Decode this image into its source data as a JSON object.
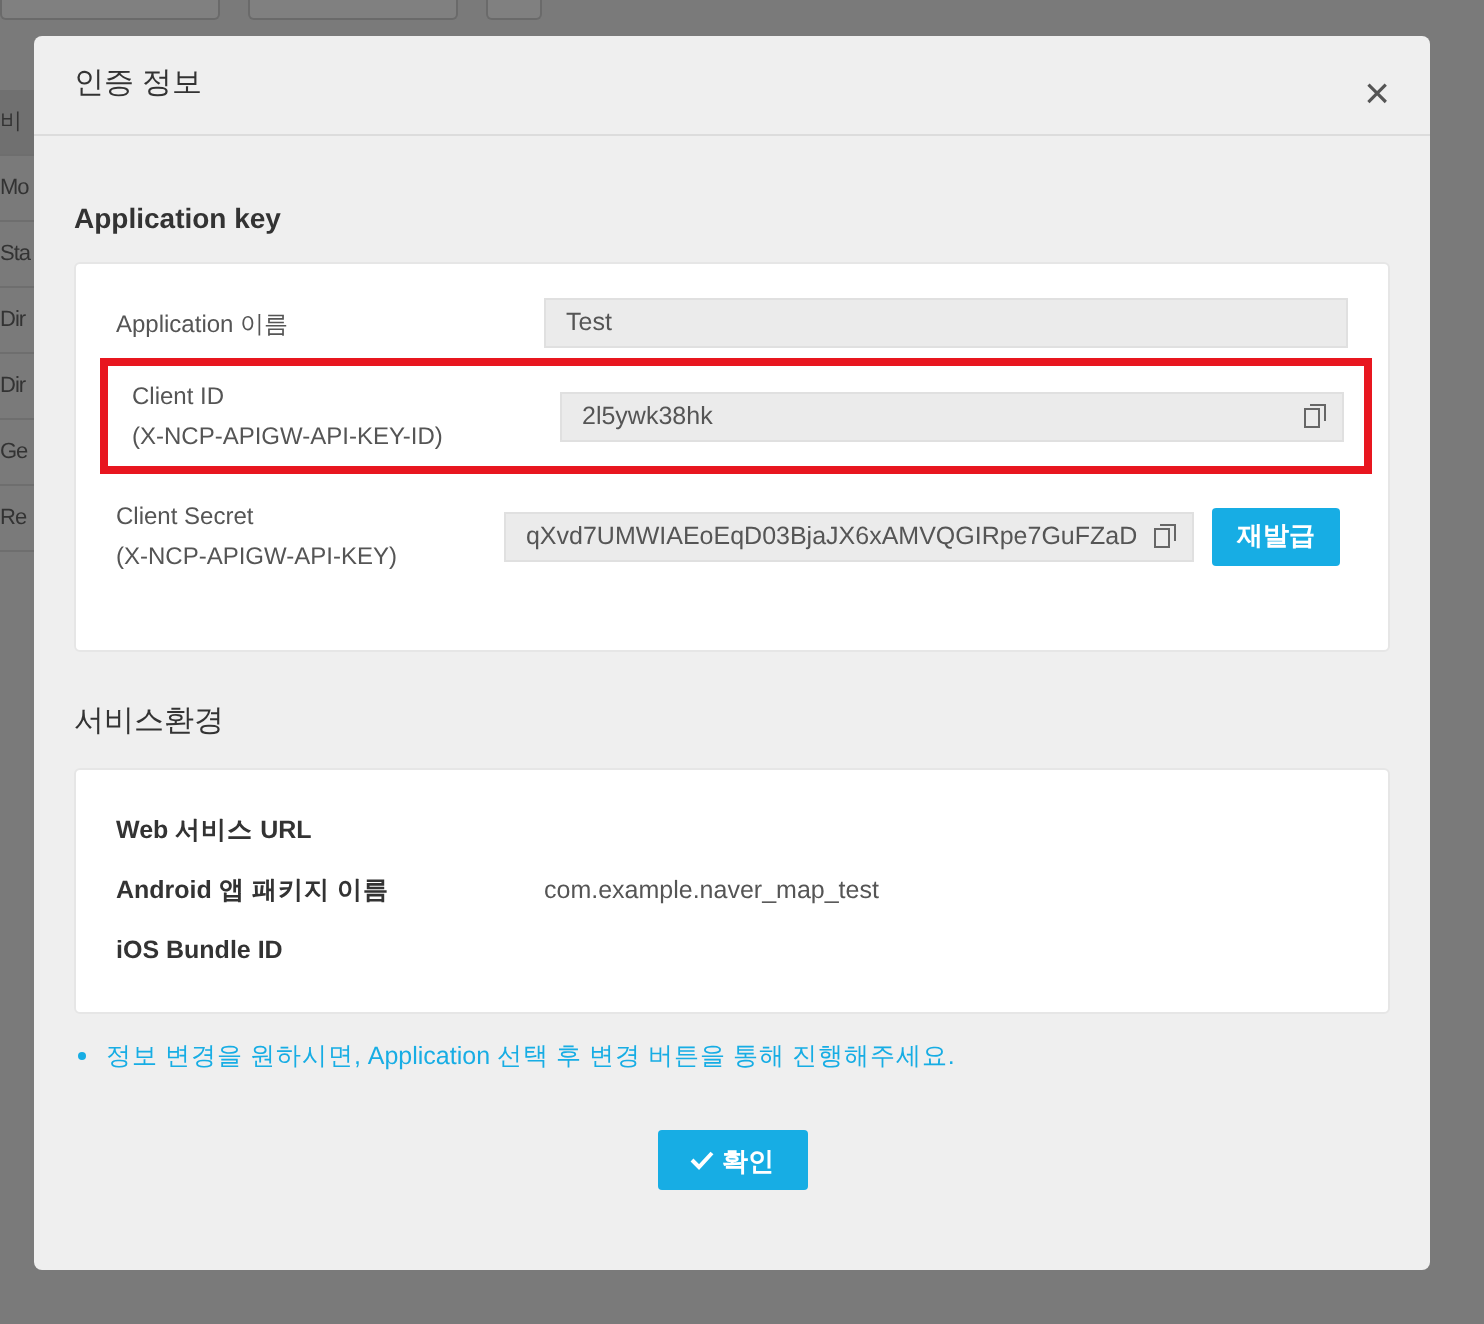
{
  "background": {
    "table_rows": [
      "비",
      "Mo",
      "Sta",
      "Dir",
      "Dir",
      "Ge",
      "Re"
    ]
  },
  "dialog": {
    "title": "인증 정보",
    "close": "×",
    "sections": [
      {
        "title": "Application key",
        "kind": "keys",
        "rows": [
          {
            "label": "Application 이름",
            "value": "Test",
            "copy": false,
            "highlighted": false
          },
          {
            "label": "Client ID",
            "sublabel": "(X-NCP-APIGW-API-KEY-ID)",
            "value": "2l5ywk38hk",
            "copy": true,
            "highlighted": true
          },
          {
            "label": "Client Secret",
            "sublabel": "(X-NCP-APIGW-API-KEY)",
            "value": "qXvd7UMWIAEoEqD03BjaJX6xAMVQGIRpe7GuFZaD",
            "copy": true,
            "highlighted": false,
            "button": "재발급"
          }
        ]
      },
      {
        "title": "서비스환경",
        "kind": "env",
        "rows": [
          {
            "label": "Web 서비스 URL"
          },
          {
            "label": "Android 앱 패키지 이름",
            "value": "com.example.naver_map_test"
          },
          {
            "label": "iOS Bundle ID"
          }
        ]
      }
    ],
    "note": "정보 변경을 원하시면, Application 선택 후 변경 버튼을 통해 진행해주세요.",
    "ok_button": "확인"
  }
}
